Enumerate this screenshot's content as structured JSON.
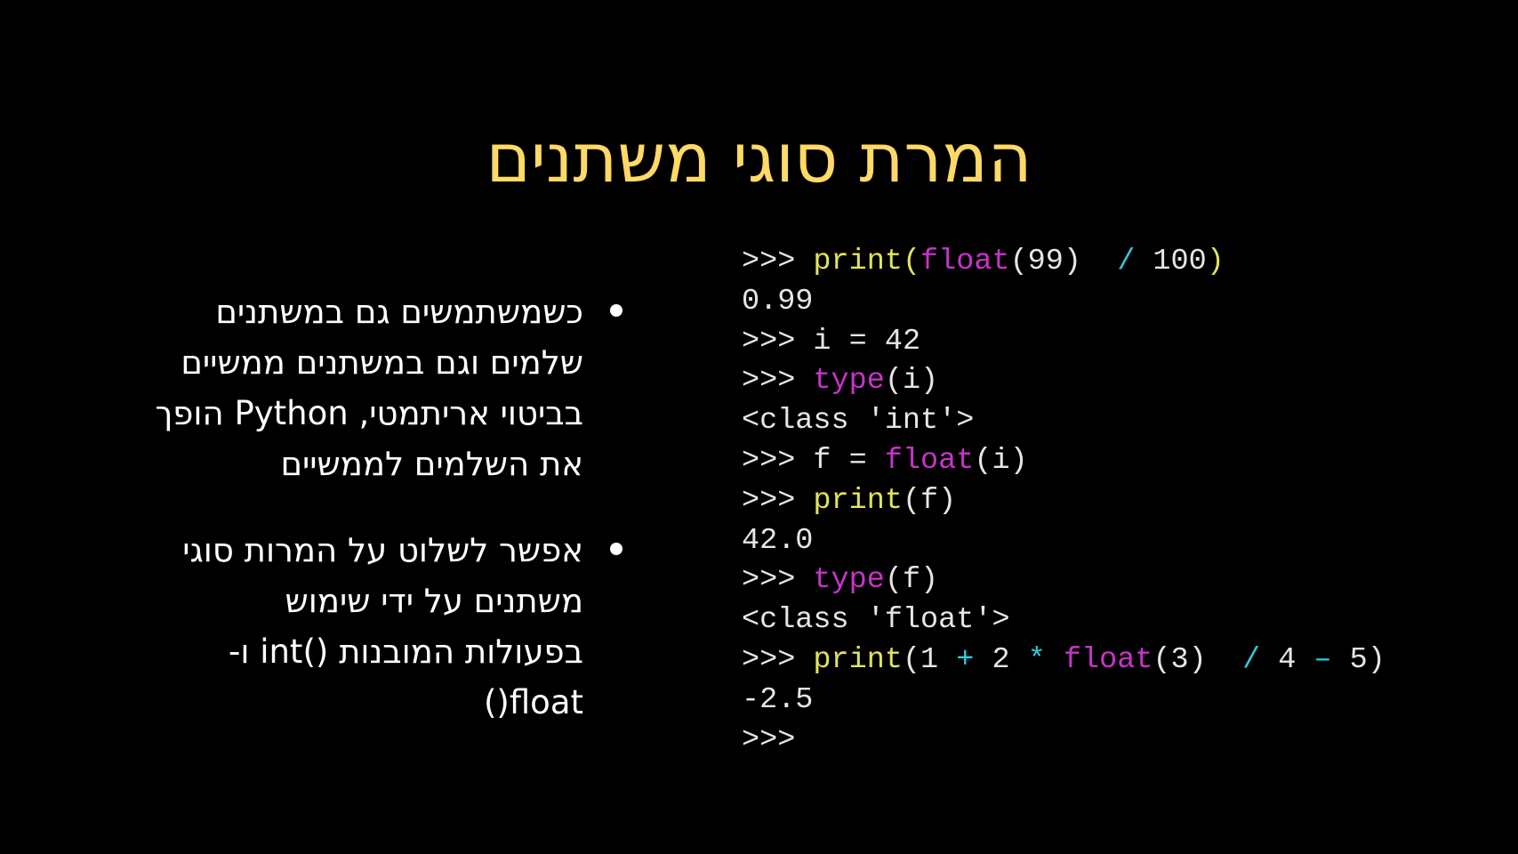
{
  "title": "המרת סוגי משתנים",
  "bullets": [
    {
      "lines": [
        "כשמשתמשים גם במשתנים",
        "שלמים וגם במשתנים ממשיים",
        "בביטוי אריתמטי, Python הופך",
        "את השלמים לממשיים"
      ]
    },
    {
      "lines": [
        "אפשר לשלוט על המרות סוגי",
        "משתנים על ידי שימוש",
        "בפעולות המובנות ()int ו-",
        "float()"
      ]
    }
  ],
  "console": {
    "colors": {
      "default": "#e6e6e6",
      "builtin": "#e3e35a",
      "type_keyword": "#c833c8",
      "operator": "#35c8d8"
    },
    "lines": [
      [
        {
          "text": ">>> ",
          "style": "prompt"
        },
        {
          "text": "print(",
          "style": "yellow"
        },
        {
          "text": "float",
          "style": "magenta"
        },
        {
          "text": "(99)  ",
          "style": "default"
        },
        {
          "text": "/ ",
          "style": "cyan"
        },
        {
          "text": "100",
          "style": "default"
        },
        {
          "text": ")",
          "style": "yellow"
        }
      ],
      [
        {
          "text": "0.99",
          "style": "default"
        }
      ],
      [
        {
          "text": ">>> ",
          "style": "prompt"
        },
        {
          "text": "i = 42",
          "style": "default"
        }
      ],
      [
        {
          "text": ">>> ",
          "style": "prompt"
        },
        {
          "text": "type",
          "style": "magenta"
        },
        {
          "text": "(i)",
          "style": "default"
        }
      ],
      [
        {
          "text": "<class 'int'>",
          "style": "default"
        }
      ],
      [
        {
          "text": ">>> ",
          "style": "prompt"
        },
        {
          "text": "f = ",
          "style": "default"
        },
        {
          "text": "float",
          "style": "magenta"
        },
        {
          "text": "(i)",
          "style": "default"
        }
      ],
      [
        {
          "text": ">>> ",
          "style": "prompt"
        },
        {
          "text": "print",
          "style": "yellow"
        },
        {
          "text": "(f)",
          "style": "default"
        }
      ],
      [
        {
          "text": "42.0",
          "style": "default"
        }
      ],
      [
        {
          "text": ">>> ",
          "style": "prompt"
        },
        {
          "text": "type",
          "style": "magenta"
        },
        {
          "text": "(f)",
          "style": "default"
        }
      ],
      [
        {
          "text": "<class 'float'>",
          "style": "default"
        }
      ],
      [
        {
          "text": ">>> ",
          "style": "prompt"
        },
        {
          "text": "print",
          "style": "yellow"
        },
        {
          "text": "(1 ",
          "style": "default"
        },
        {
          "text": "+ ",
          "style": "cyan"
        },
        {
          "text": "2 ",
          "style": "default"
        },
        {
          "text": "* ",
          "style": "cyan"
        },
        {
          "text": "float",
          "style": "magenta"
        },
        {
          "text": "(3)  ",
          "style": "default"
        },
        {
          "text": "/ ",
          "style": "cyan"
        },
        {
          "text": "4 ",
          "style": "default"
        },
        {
          "text": "– ",
          "style": "cyan"
        },
        {
          "text": "5)",
          "style": "default"
        }
      ],
      [
        {
          "text": "-2.5",
          "style": "default"
        }
      ],
      [
        {
          "text": ">>>",
          "style": "prompt"
        }
      ]
    ]
  }
}
